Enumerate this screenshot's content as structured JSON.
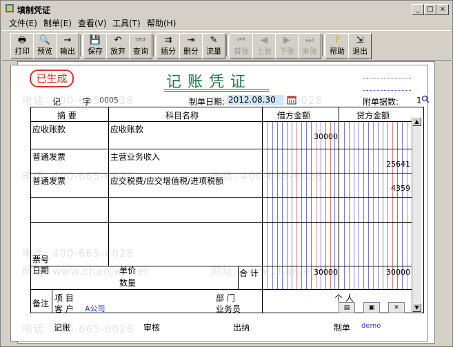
{
  "window": {
    "title": "填制凭证"
  },
  "menu": [
    "文件(E)",
    "制单(E)",
    "查看(V)",
    "工具(T)",
    "帮助(H)"
  ],
  "toolbar": {
    "print": "打印",
    "preview": "预览",
    "export": "输出",
    "save": "保存",
    "discard": "放弃",
    "query": "查询",
    "insert": "插分",
    "delete": "删分",
    "flow": "流量",
    "first": "首张",
    "prev": "上张",
    "next": "下张",
    "last": "末张",
    "help": "帮助",
    "exit": "退出"
  },
  "voucher": {
    "stamp": "已生成",
    "title": "记账凭证",
    "type_label": "记",
    "zi_label": "字",
    "number": "0005",
    "date_label": "制单日期:",
    "date": "2012.08.30",
    "attach_label": "附单据数:",
    "attach_count": "1"
  },
  "table": {
    "headers": {
      "summary": "摘  要",
      "account": "科目名称",
      "debit": "借方金额",
      "credit": "贷方金额"
    },
    "rows": [
      {
        "summary": "应收账款",
        "account": "应收账款",
        "debit": "30000",
        "credit": ""
      },
      {
        "summary": "普通发票",
        "account": "主营业务收入",
        "debit": "",
        "credit": "25641"
      },
      {
        "summary": "普通发票",
        "account": "应交税费/应交增值税/进项税额",
        "debit": "",
        "credit": "4359"
      }
    ],
    "ticket_label": "票号",
    "date_label": "日期",
    "price_label": "单价",
    "qty_label": "数量",
    "total_label": "合 计",
    "total_debit": "30000",
    "total_credit": "30000"
  },
  "footer": {
    "remark_label": "备注",
    "project_label": "项  目",
    "customer_label": "客  户",
    "customer_value": "A公司",
    "dept_label": "部  门",
    "person_label": "个  人",
    "clerk_label": "业务员",
    "bookkeeper_label": "记账",
    "auditor_label": "审核",
    "cashier_label": "出纳",
    "maker_label": "制单",
    "maker_value": "demo"
  },
  "watermark": {
    "phone": "电话: 400-665-0028",
    "site": "网址: www.chanjet.net"
  },
  "colors": {
    "stamp": "#d83030",
    "title": "#1a7a4a",
    "date_bg": "#cfe6f7",
    "link": "#2b3fc0"
  }
}
